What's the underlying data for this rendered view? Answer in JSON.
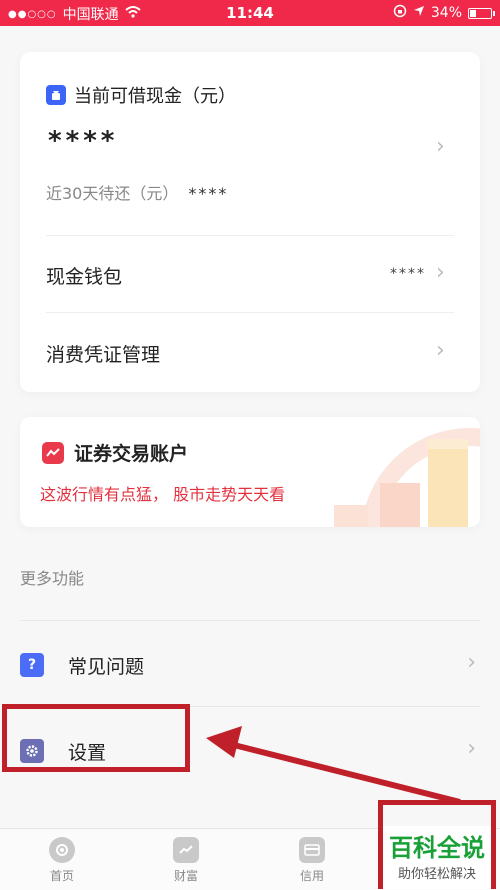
{
  "status": {
    "carrier": "中国联通",
    "time": "11:44",
    "battery": "34%",
    "battery_level": 0.34
  },
  "wallet": {
    "title": "当前可借现金（元）",
    "amount": "****",
    "due_label": "近30天待还（元）",
    "due_value": "****",
    "cash_wallet_label": "现金钱包",
    "cash_wallet_value": "****",
    "voucher_label": "消费凭证管理"
  },
  "securities": {
    "title": "证券交易账户",
    "slogan": "这波行情有点猛， 股市走势天天看"
  },
  "more": {
    "header": "更多功能",
    "items": [
      {
        "label": "常见问题",
        "icon": "question-icon",
        "color": "#4a6cf7"
      },
      {
        "label": "设置",
        "icon": "gear-icon",
        "color": "#6c6fb4"
      }
    ]
  },
  "tabs": [
    {
      "label": "首页",
      "icon": "home-icon"
    },
    {
      "label": "财富",
      "icon": "wealth-icon"
    },
    {
      "label": "信用",
      "icon": "credit-card-icon"
    }
  ],
  "watermark": {
    "title": "百科全说",
    "subtitle": "助你轻松解决"
  },
  "colors": {
    "status_bar": "#f0294a",
    "accent_red": "#e3323f",
    "annotation": "#c0202a"
  }
}
